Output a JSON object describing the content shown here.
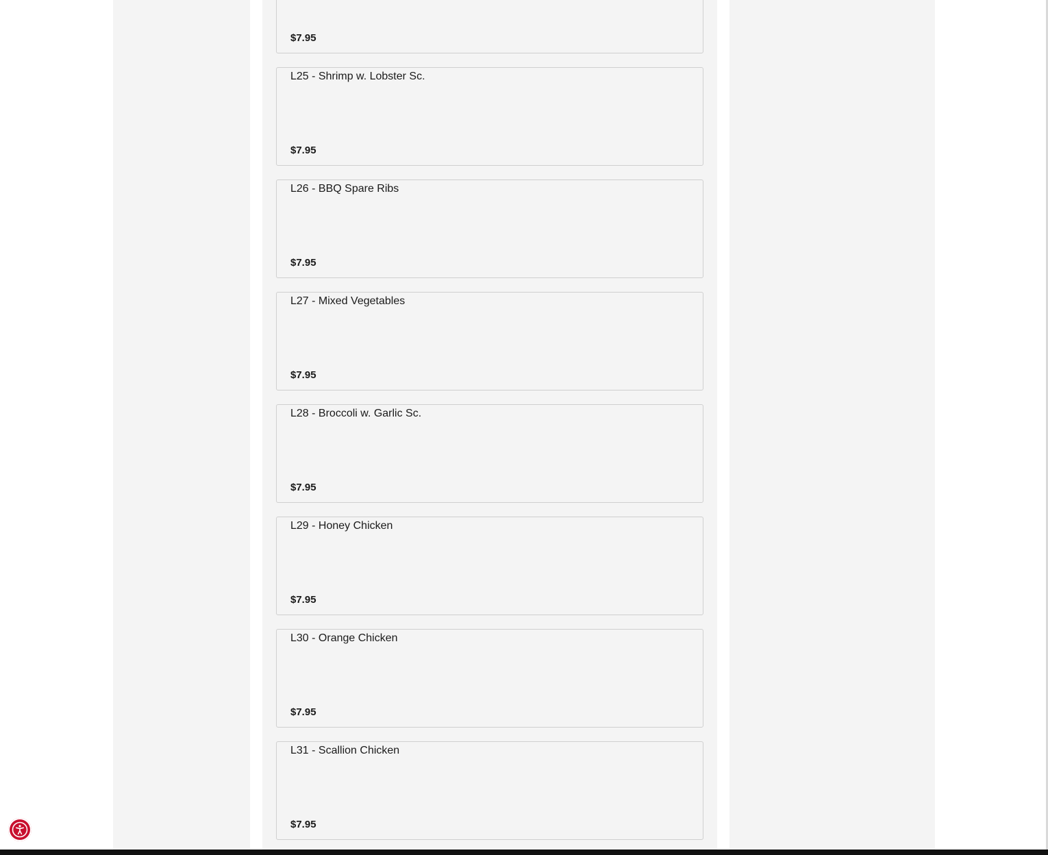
{
  "colors": {
    "panel_bg": "#f4f4f4",
    "card_border": "#cfcfcf",
    "accessibility_button": "#c8102e",
    "bottom_bar": "#111111"
  },
  "menu_items": [
    {
      "name": "",
      "price": "$7.95"
    },
    {
      "name": "L25 - Shrimp w. Lobster Sc.",
      "price": "$7.95"
    },
    {
      "name": "L26 - BBQ Spare Ribs",
      "price": "$7.95"
    },
    {
      "name": "L27 - Mixed Vegetables",
      "price": "$7.95"
    },
    {
      "name": "L28 - Broccoli w. Garlic Sc.",
      "price": "$7.95"
    },
    {
      "name": "L29 - Honey Chicken",
      "price": "$7.95"
    },
    {
      "name": "L30 - Orange Chicken",
      "price": "$7.95"
    },
    {
      "name": "L31 - Scallion Chicken",
      "price": "$7.95"
    }
  ],
  "accessibility": {
    "icon": "accessibility-icon"
  }
}
